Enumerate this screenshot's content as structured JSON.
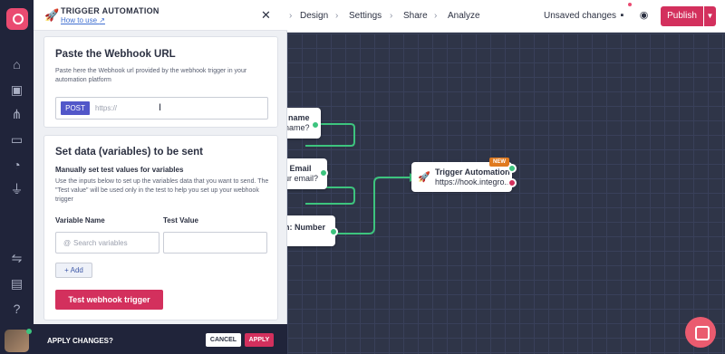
{
  "panel": {
    "title": "TRIGGER AUTOMATION",
    "how_to_use": "How to use",
    "close_icon": "close-icon",
    "webhook": {
      "heading": "Paste the Webhook URL",
      "help": "Paste here the Webhook url provided by the webhook trigger in your automation platform",
      "method": "POST",
      "url_placeholder": "https://",
      "url_value": ""
    },
    "variables": {
      "heading": "Set data (variables) to be sent",
      "subheading": "Manually set test values for variables",
      "help": "Use the inputs below to set up the variables data that you want to send. The \"Test value\" will be used only in the test to help you set up your webhook trigger",
      "col_variable": "Variable Name",
      "col_test_value": "Test Value",
      "var_prefix": "@",
      "var_placeholder": "Search variables",
      "test_value": "",
      "add_label": "+ Add",
      "test_button": "Test webhook trigger"
    }
  },
  "footer": {
    "label": "APPLY CHANGES?",
    "cancel": "CANCEL",
    "apply": "APPLY"
  },
  "topbar": {
    "crumbs": [
      "Design",
      "Settings",
      "Share",
      "Analyze"
    ],
    "unsaved": "Unsaved changes",
    "publish": "Publish",
    "icons": [
      "save-icon",
      "preview-eye-icon"
    ]
  },
  "canvas": {
    "nodes": [
      {
        "title": "name",
        "sub": "name?"
      },
      {
        "title": ": Email",
        "sub": "ur email?"
      },
      {
        "title": "n: Number",
        "sub": ""
      },
      {
        "title": "Trigger Automation",
        "sub": "https://hook.integro...",
        "badge": "NEW"
      }
    ]
  },
  "colors": {
    "accent": "#d3305d",
    "rail": "#20243a",
    "canvas": "#2f3548",
    "connector": "#3dc47e",
    "method_tag": "#5257c9"
  },
  "rail_icons": [
    "home-icon",
    "bot-icon",
    "broadcast-icon",
    "chat-icon",
    "analytics-icon",
    "integrations-icon",
    "handshake-icon",
    "wallet-icon",
    "help-icon"
  ]
}
